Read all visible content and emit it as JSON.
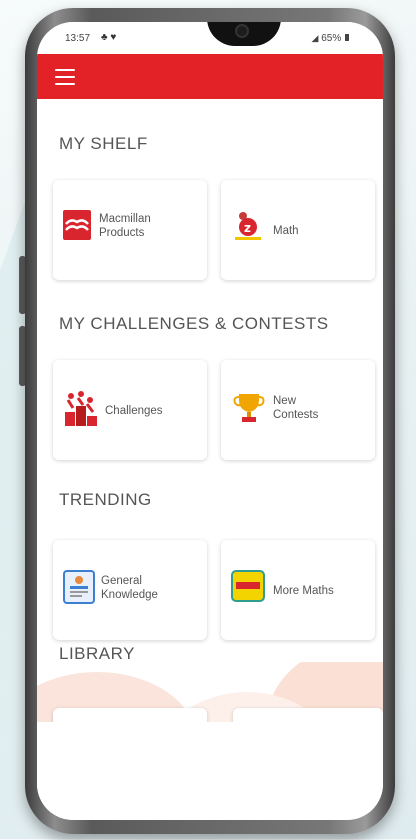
{
  "status_bar": {
    "time": "13:57",
    "left_icons": "♣ ♥",
    "right": "65%"
  },
  "sections": {
    "shelf": {
      "title": "MY SHELF",
      "items": [
        {
          "label": "Macmillan Products",
          "icon": "macmillan-logo"
        },
        {
          "label": "Math",
          "icon": "math-z-logo"
        }
      ]
    },
    "challenges": {
      "title": "MY CHALLENGES & CONTESTS",
      "items": [
        {
          "label": "Challenges",
          "icon": "podium-icon"
        },
        {
          "label": "New Contests",
          "icon": "trophy-icon"
        }
      ]
    },
    "trending": {
      "title": "TRENDING",
      "items": [
        {
          "label": "General Knowledge",
          "icon": "book-cover-icon"
        },
        {
          "label": "More Maths",
          "icon": "more-maths-cover-icon"
        }
      ]
    },
    "library": {
      "title": "LIBRARY"
    }
  },
  "colors": {
    "appbar": "#e32228",
    "text": "#555555"
  }
}
